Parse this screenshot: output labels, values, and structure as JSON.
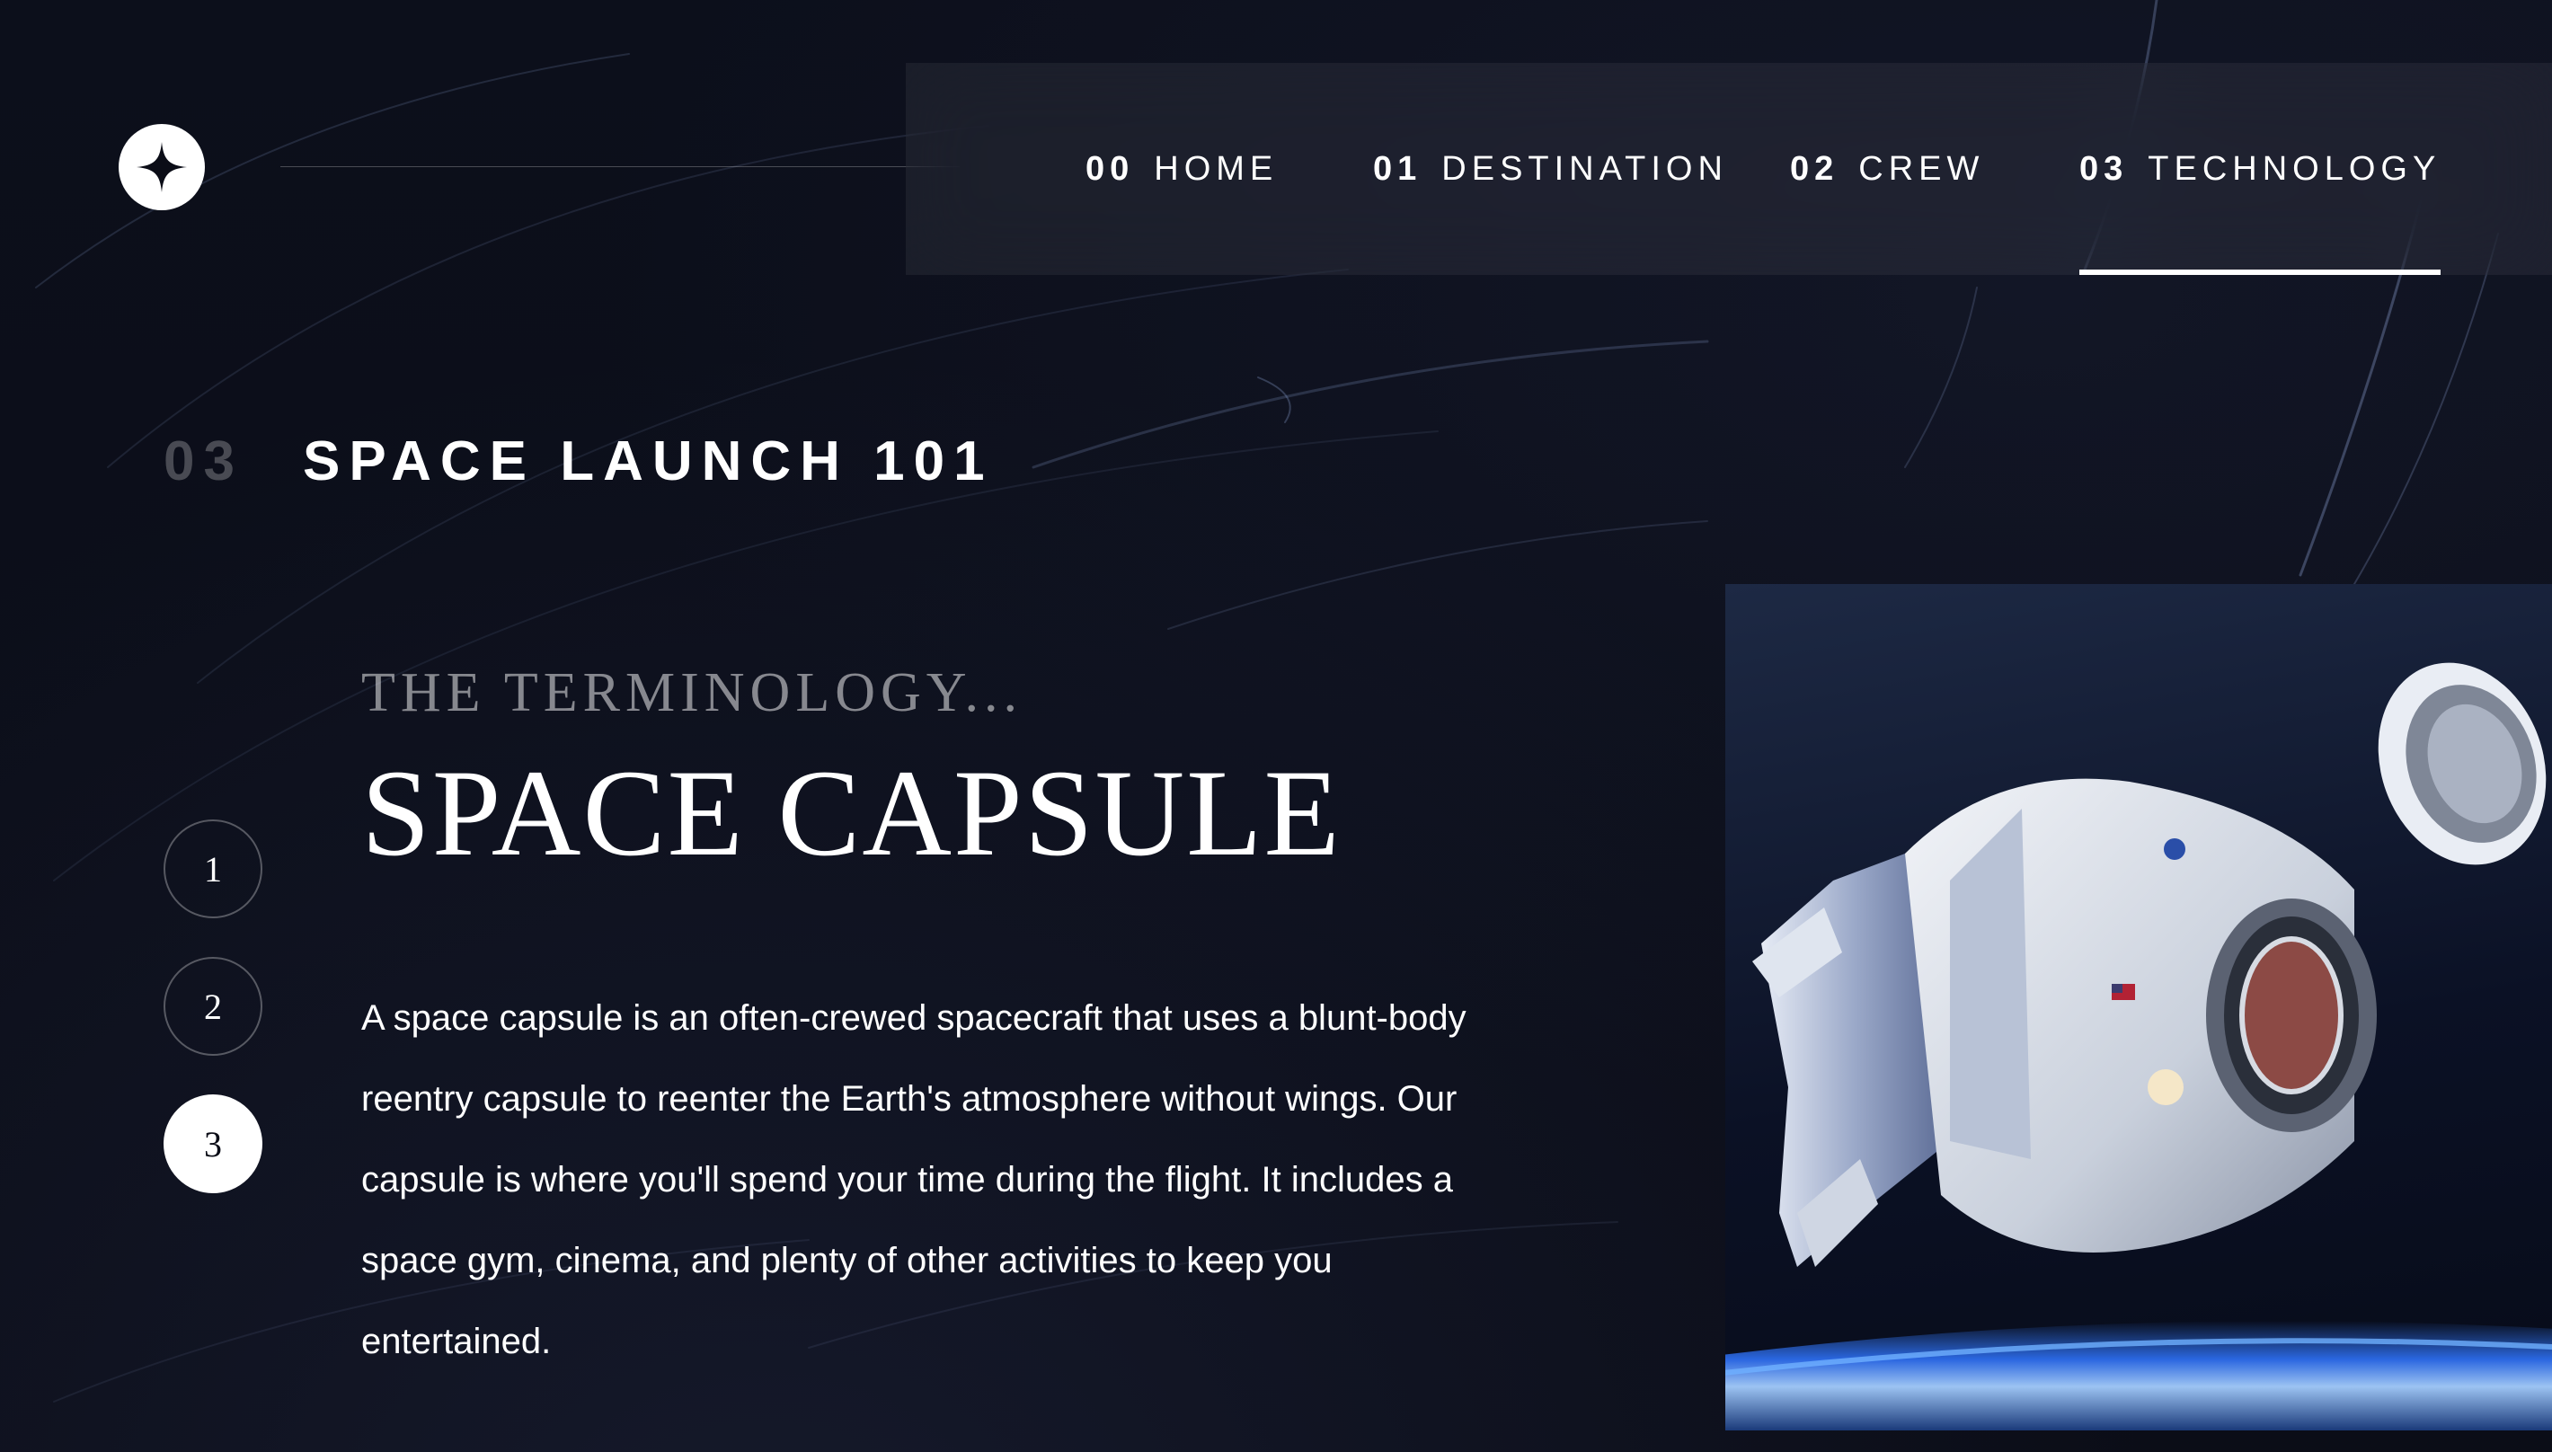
{
  "header": {
    "logo_icon": "star-logo-icon",
    "nav": [
      {
        "num": "00",
        "label": "HOME",
        "active": false
      },
      {
        "num": "01",
        "label": "DESTINATION",
        "active": false
      },
      {
        "num": "02",
        "label": "CREW",
        "active": false
      },
      {
        "num": "03",
        "label": "TECHNOLOGY",
        "active": true
      }
    ]
  },
  "page": {
    "heading_num": "03",
    "heading_text": "SPACE LAUNCH 101"
  },
  "steps": [
    {
      "label": "1",
      "active": false
    },
    {
      "label": "2",
      "active": false
    },
    {
      "label": "3",
      "active": true
    }
  ],
  "content": {
    "subheading": "THE TERMINOLOGY...",
    "title": "SPACE CAPSULE",
    "description": "A space capsule is an often-crewed spacecraft that uses a blunt-body reentry capsule to reenter the Earth's atmosphere without wings. Our capsule is where you'll spend your time during the flight. It includes a space gym, cinema, and plenty of other activities to keep you entertained."
  },
  "image": {
    "subject": "space capsule spacecraft in orbit above Earth"
  },
  "colors": {
    "background": "#0b0d17",
    "text": "#ffffff",
    "muted": "rgba(255,255,255,0.5)"
  }
}
